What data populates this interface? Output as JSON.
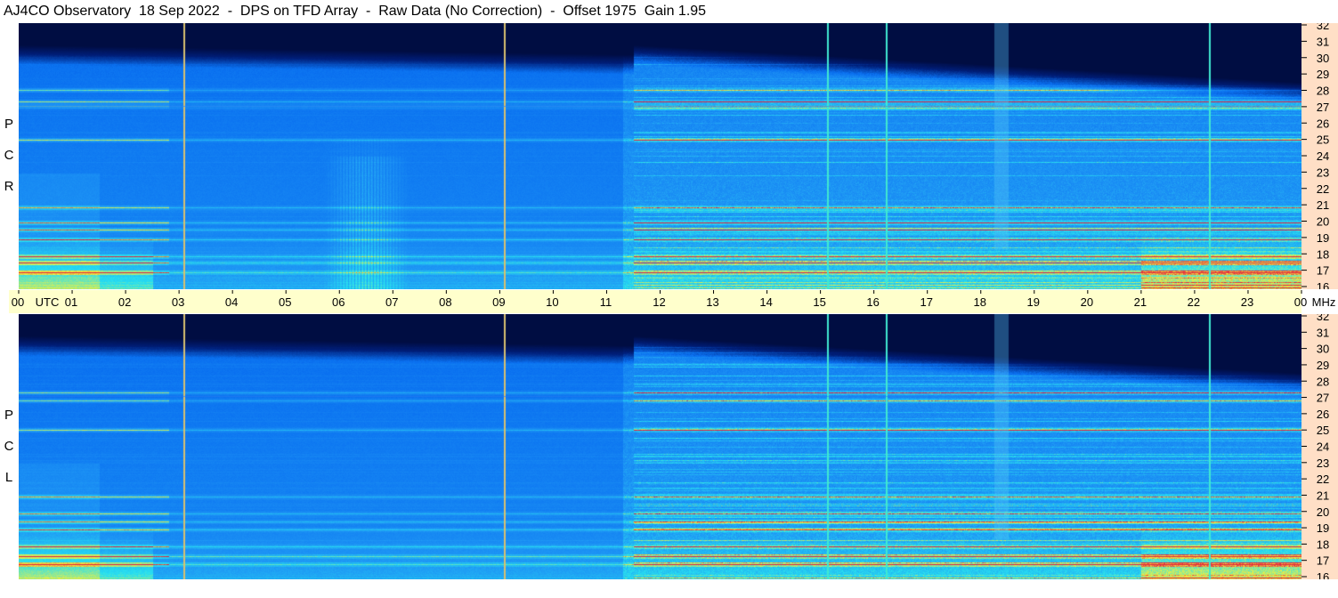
{
  "title": "AJ4CO Observatory  18 Sep 2022  -  DPS on TFD Array  -  Raw Data (No Correction)  -  Offset 1975  Gain 1.95",
  "chart_data": [
    {
      "type": "heatmap",
      "panel": "top",
      "side_label": [
        "R",
        "C",
        "P"
      ],
      "x_ticks": [
        "00",
        "01",
        "02",
        "03",
        "04",
        "05",
        "06",
        "07",
        "08",
        "09",
        "10",
        "11",
        "12",
        "13",
        "14",
        "15",
        "16",
        "17",
        "18",
        "19",
        "20",
        "21",
        "22",
        "23",
        "00"
      ],
      "x_unit": "UTC",
      "xlim": [
        0,
        24
      ],
      "y_ticks": [
        16,
        17,
        18,
        19,
        20,
        21,
        22,
        23,
        24,
        25,
        26,
        27,
        28,
        29,
        30,
        31,
        32
      ],
      "y_unit": "MHz",
      "ylim": [
        16,
        32
      ],
      "vertical_lines_utc": [
        3.08,
        9.08,
        15.13,
        16.23,
        22.27
      ],
      "horizontal_bands_mhz": [
        17.0,
        17.6,
        18.0,
        19.0,
        19.6,
        20.0,
        20.9,
        25.0,
        27.0,
        27.3,
        28.0
      ],
      "burst_region_utc": [
        5.7,
        7.3
      ]
    },
    {
      "type": "heatmap",
      "panel": "bottom",
      "side_label": [
        "L",
        "C",
        "P"
      ],
      "x_ticks": [
        "00",
        "01",
        "02",
        "03",
        "04",
        "05",
        "06",
        "07",
        "08",
        "09",
        "10",
        "11",
        "12",
        "13",
        "14",
        "15",
        "16",
        "17",
        "18",
        "19",
        "20",
        "21",
        "22",
        "23",
        "00"
      ],
      "x_unit": "UTC",
      "xlim": [
        0,
        24
      ],
      "y_ticks": [
        16,
        17,
        18,
        19,
        20,
        21,
        22,
        23,
        24,
        25,
        26,
        27,
        28,
        29,
        30,
        31,
        32
      ],
      "y_unit": "MHz",
      "ylim": [
        16,
        32
      ],
      "vertical_lines_utc": [
        3.08,
        9.08,
        15.13,
        16.23,
        22.27
      ],
      "horizontal_bands_mhz": [
        16.9,
        17.4,
        18.0,
        19.0,
        19.5,
        20.0,
        21.0,
        25.0,
        26.8,
        27.3
      ],
      "burst_region_utc": []
    }
  ],
  "colors": {
    "utc_band": "#ffffcc",
    "freq_band": "#ffdfc6",
    "low_signal": "#000a3a",
    "background_blue": "#0a70f0",
    "noise_cyan": "#28e0f0",
    "strong_yellow": "#f0f040",
    "peak_red": "#e02040"
  }
}
